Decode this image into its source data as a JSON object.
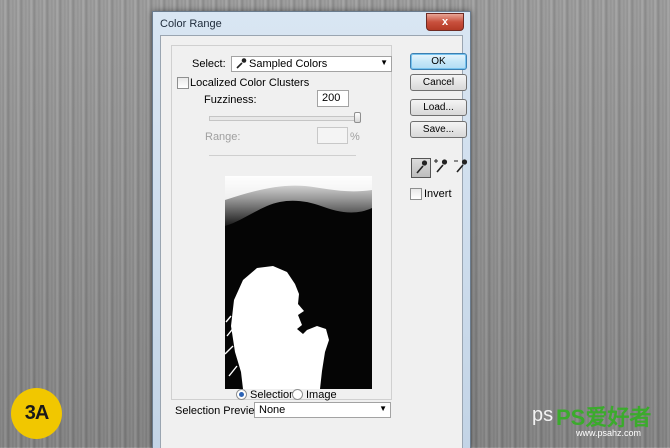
{
  "dialog": {
    "title": "Color Range",
    "close_label": "x",
    "select_label": "Select:",
    "select_value": "Sampled Colors",
    "localized_label": "Localized Color Clusters",
    "fuzziness_label": "Fuzziness:",
    "fuzziness_value": "200",
    "fuzziness_level": 1.0,
    "range_label": "Range:",
    "range_unit": "%",
    "range_value": "",
    "view_selection_label": "Selection",
    "view_image_label": "Image",
    "view_selected": "Selection",
    "selection_preview_label": "Selection Preview:",
    "selection_preview_value": "None",
    "invert_label": "Invert",
    "buttons": {
      "ok": "OK",
      "cancel": "Cancel",
      "load": "Load...",
      "save": "Save..."
    },
    "tools": [
      "eyedropper-icon",
      "eyedropper-plus-icon",
      "eyedropper-minus-icon"
    ]
  },
  "watermarks": {
    "left_logo": "3A",
    "right_logo": "PS爱好者",
    "right_site_partial": "ps",
    "right_site_small": "www.psahz.com"
  },
  "colors": {
    "ok_accent": "#78c3ee",
    "logo_yellow": "#f1c700",
    "watermark_green": "#3bab2c"
  }
}
